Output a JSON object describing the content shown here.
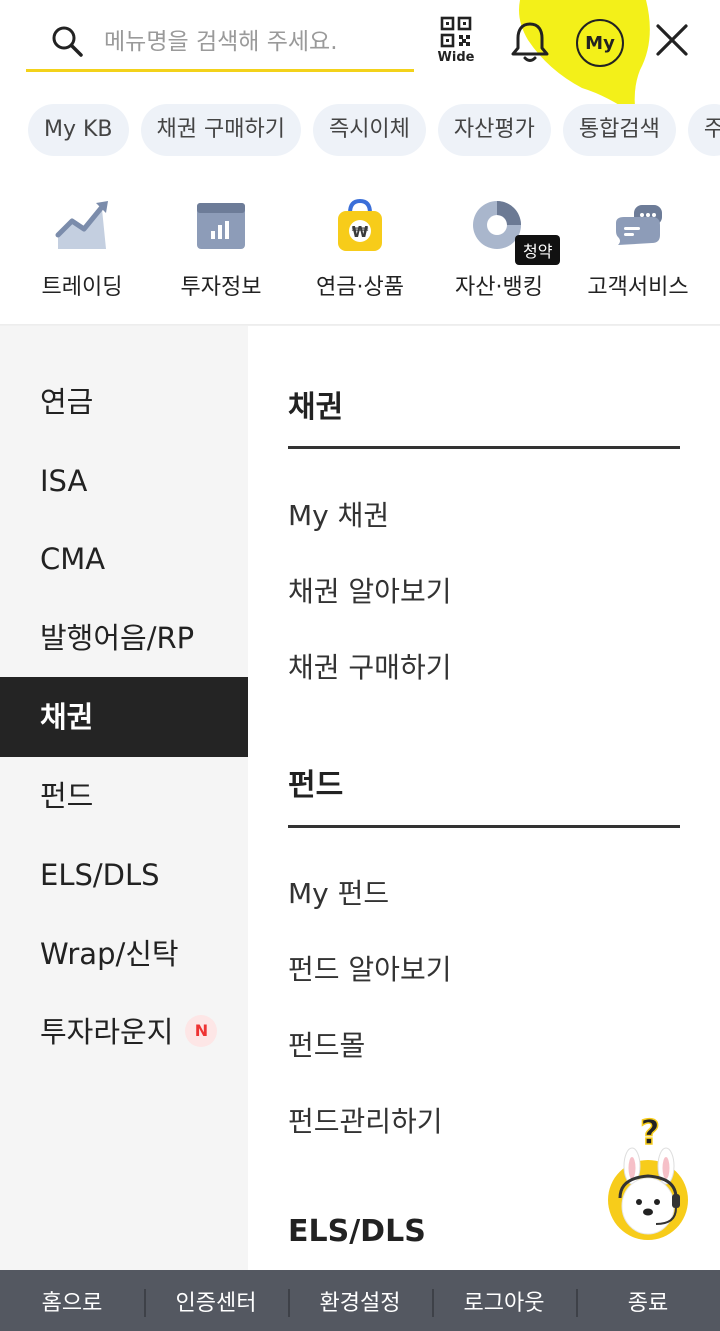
{
  "search": {
    "placeholder": "메뉴명을 검색해 주세요."
  },
  "header": {
    "qr_label": "Wide",
    "my_label": "My"
  },
  "colors": {
    "accent": "#f3d21a",
    "highlight": "#f2ee00",
    "chip_bg": "#eef2f8",
    "active_bg": "#242424",
    "bottom_bar": "#545861"
  },
  "chips": [
    "My KB",
    "채권 구매하기",
    "즉시이체",
    "자산평가",
    "통합검색",
    "주"
  ],
  "quick_menu": [
    {
      "label": "트레이딩",
      "icon": "chart-up-icon"
    },
    {
      "label": "투자정보",
      "icon": "report-icon"
    },
    {
      "label": "연금·상품",
      "icon": "bag-icon"
    },
    {
      "label": "자산·뱅킹",
      "icon": "pie-icon",
      "badge": "청약"
    },
    {
      "label": "고객서비스",
      "icon": "chat-icon"
    }
  ],
  "left_menu": [
    {
      "label": "연금"
    },
    {
      "label": "ISA"
    },
    {
      "label": "CMA"
    },
    {
      "label": "발행어음/RP"
    },
    {
      "label": "채권",
      "active": true
    },
    {
      "label": "펀드"
    },
    {
      "label": "ELS/DLS"
    },
    {
      "label": "Wrap/신탁"
    },
    {
      "label": "투자라운지",
      "badge": "N"
    }
  ],
  "sections": [
    {
      "title": "채권",
      "items": [
        "My 채권",
        "채권 알아보기",
        "채권 구매하기"
      ]
    },
    {
      "title": "펀드",
      "items": [
        "My 펀드",
        "펀드 알아보기",
        "펀드몰",
        "펀드관리하기"
      ]
    },
    {
      "title": "ELS/DLS",
      "items": []
    }
  ],
  "mascot": {
    "symbol": "?"
  },
  "bottom_bar": [
    "홈으로",
    "인증센터",
    "환경설정",
    "로그아웃",
    "종료"
  ]
}
